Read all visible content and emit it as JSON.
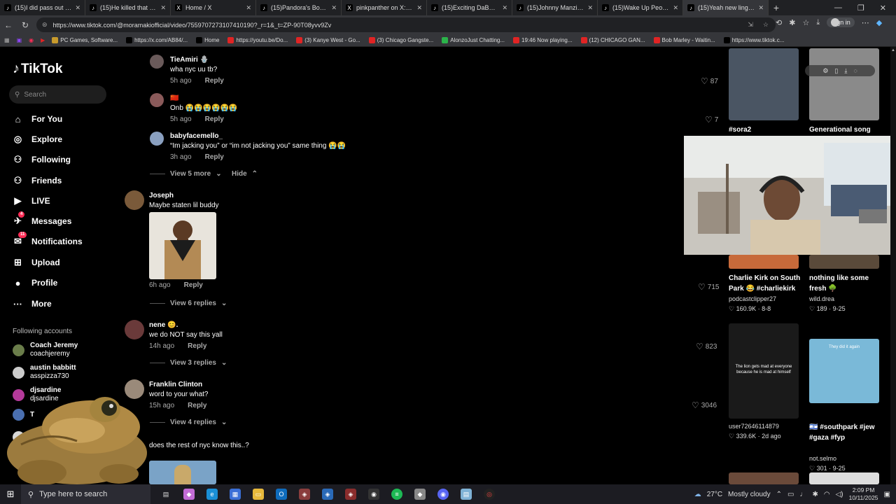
{
  "browser": {
    "tabs": [
      {
        "title": "(15)I did pass out early",
        "icon": "tiktok"
      },
      {
        "title": "(15)He killed that danc",
        "icon": "tiktok"
      },
      {
        "title": "Home / X",
        "icon": "x"
      },
      {
        "title": "(15)Pandora's Box in Al",
        "icon": "tiktok"
      },
      {
        "title": "pinkpanther on X: \"Jake",
        "icon": "x"
      },
      {
        "title": "(15)Exciting DaBaby Ed",
        "icon": "tiktok"
      },
      {
        "title": "(15)Johnny Manziel: El",
        "icon": "tiktok"
      },
      {
        "title": "(15)Wake Up People",
        "icon": "tiktok"
      },
      {
        "title": "(15)Yeah new lingo in t",
        "icon": "tiktok"
      }
    ],
    "url": "https://www.tiktok.com/@moramakiofficial/video/7559707273107410190?_r=1&_t=ZP-90T08yvv9Zv",
    "signin": "Sign in",
    "bookmarks": [
      {
        "label": "PC Games, Software...",
        "color": "#c79a2c"
      },
      {
        "label": "https://x.com/AB84/...",
        "color": "#000"
      },
      {
        "label": "Home",
        "color": "#000"
      },
      {
        "label": "https://youtu.be/Do...",
        "color": "#e02424"
      },
      {
        "label": "(3) Kanye West - Go...",
        "color": "#e02424"
      },
      {
        "label": "(3) Chicago Gangste...",
        "color": "#e02424"
      },
      {
        "label": "AlonzoJust Chatting...",
        "color": "#2bb34a"
      },
      {
        "label": "19:46 Now playing...",
        "color": "#e02424"
      },
      {
        "label": "(12) CHICAGO GAN...",
        "color": "#e02424"
      },
      {
        "label": "Bob Marley - Waitin...",
        "color": "#e02424"
      },
      {
        "label": "https://www.tiktok.c...",
        "color": "#000"
      }
    ]
  },
  "sidebar": {
    "logo": "TikTok",
    "search_placeholder": "Search",
    "nav": [
      {
        "label": "For You",
        "icon": "home-icon",
        "glyph": "⌂"
      },
      {
        "label": "Explore",
        "icon": "compass-icon",
        "glyph": "◎"
      },
      {
        "label": "Following",
        "icon": "following-icon",
        "glyph": "⚇"
      },
      {
        "label": "Friends",
        "icon": "friends-icon",
        "glyph": "⚇"
      },
      {
        "label": "LIVE",
        "icon": "live-icon",
        "glyph": "▶"
      },
      {
        "label": "Messages",
        "icon": "messages-icon",
        "glyph": "✈",
        "badge": "4"
      },
      {
        "label": "Notifications",
        "icon": "bell-icon",
        "glyph": "✉",
        "badge": "11"
      },
      {
        "label": "Upload",
        "icon": "plus-icon",
        "glyph": "⊞"
      },
      {
        "label": "Profile",
        "icon": "profile-icon",
        "glyph": "●"
      },
      {
        "label": "More",
        "icon": "more-icon",
        "glyph": "···"
      }
    ],
    "following_title": "Following accounts",
    "accounts": [
      {
        "name": "Coach Jeremy",
        "handle": "coachjeremy",
        "color": "#6a7d4a"
      },
      {
        "name": "austin babbitt",
        "handle": "asspizza730",
        "color": "#cccccc"
      },
      {
        "name": "djsardine",
        "handle": "djsardine",
        "color": "#b43a9a"
      },
      {
        "name": "T",
        "handle": "",
        "color": "#4a6fb0"
      },
      {
        "name": "",
        "handle": "",
        "color": "#d8d8d8"
      }
    ]
  },
  "comments": [
    {
      "name": "TieAmiri 🪬",
      "text": "wha nyc uu tb?",
      "time": "5h ago",
      "reply": "Reply",
      "likes": "87"
    },
    {
      "name": "🇨🇳",
      "text": "Onb 😭😭😭😭😭😭",
      "time": "5h ago",
      "reply": "Reply",
      "likes": "7"
    },
    {
      "name": "babyfacemello_",
      "text": "“Im jacking you” or “im not jacking you” same thing 😭😭",
      "time": "3h ago",
      "reply": "Reply",
      "likes": ""
    },
    {
      "name": "Joseph",
      "text": "Maybe staten lil buddy",
      "time": "6h ago",
      "reply": "Reply",
      "likes": "715"
    },
    {
      "name": "nene 😊.",
      "text": "we do NOT say this yall",
      "time": "14h ago",
      "reply": "Reply",
      "likes": "823"
    },
    {
      "name": "Franklin Clinton",
      "text": "word to your what?",
      "time": "15h ago",
      "reply": "Reply",
      "likes": "3046"
    },
    {
      "name": "",
      "text": "does the rest of nyc know this..?",
      "time": "",
      "reply": "",
      "likes": ""
    }
  ],
  "view_replies": [
    "View 5 more",
    "View 6 replies",
    "View 3 replies",
    "View 4 replies"
  ],
  "hide_label": "Hide",
  "videos": [
    {
      "title": "#sora2",
      "author": "",
      "stats": ""
    },
    {
      "title": "Generational song",
      "author": "",
      "stats": ""
    },
    {
      "title": "Charlie Kirk on South Park 😂 #charliekirk",
      "author": "podcastclipper27",
      "likes": "160.9K",
      "date": "8-8"
    },
    {
      "title": "nothing like some fresh 🌳",
      "author": "wild.drea",
      "likes": "189",
      "date": "9-25"
    },
    {
      "title": "",
      "author": "user72646114879",
      "likes": "339.6K",
      "date": "2d ago",
      "overlay": "The lion gets mad at everyone because he is mad at himself"
    },
    {
      "title": "🇮🇱 #southpark #jew #gaza #fyp",
      "author": "not.selmo",
      "likes": "301",
      "date": "9-25",
      "overlay": "They did it again"
    }
  ],
  "taskbar": {
    "search_placeholder": "Type here to search",
    "temp": "27°C",
    "weather": "Mostly cloudy",
    "time": "2:09 PM",
    "date": "10/11/2025"
  }
}
